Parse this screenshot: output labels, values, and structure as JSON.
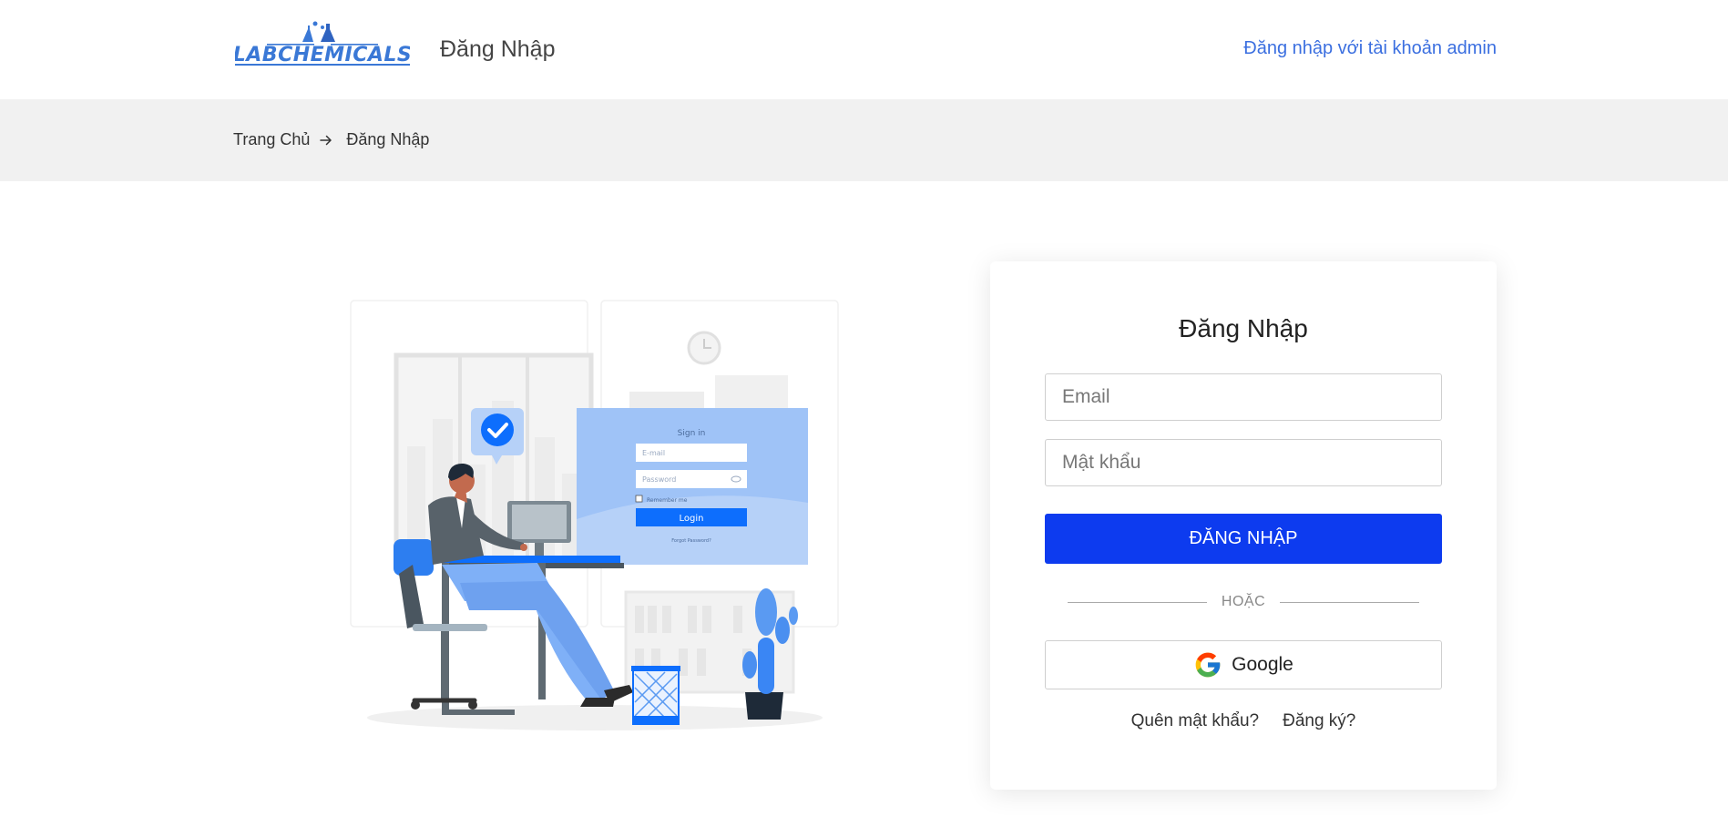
{
  "header": {
    "logo_text": "LABCHEMICALS",
    "title": "Đăng Nhập",
    "admin_link": "Đăng nhập với tài khoản admin"
  },
  "breadcrumb": {
    "home": "Trang Chủ",
    "current": "Đăng Nhập"
  },
  "illustration": {
    "panel_title": "Sign in",
    "email_placeholder": "E-mail",
    "password_placeholder": "Password",
    "remember": "Remember me",
    "login_button": "Login",
    "forgot": "Forgot Password?"
  },
  "login_form": {
    "title": "Đăng Nhập",
    "email_placeholder": "Email",
    "password_placeholder": "Mật khẩu",
    "submit_label": "ĐĂNG NHẬP",
    "divider_label": "HOẶC",
    "google_label": "Google",
    "forgot_label": "Quên mật khẩu?",
    "register_label": "Đăng ký?"
  },
  "colors": {
    "accent": "#0d3bef",
    "link": "#3b6fe0",
    "breadcrumb_bg": "#f1f1f1",
    "illustration_blue": "#4a8ff0"
  }
}
